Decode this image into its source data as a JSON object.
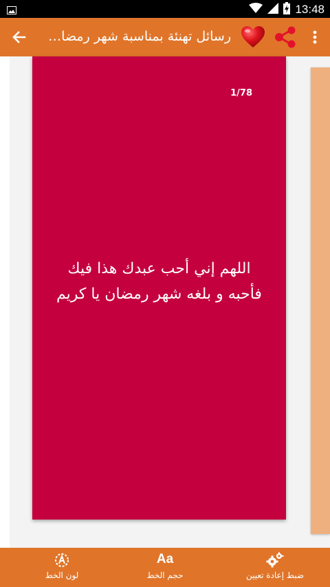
{
  "status_bar": {
    "time": "13:48",
    "battery_level": "charging"
  },
  "app_bar": {
    "title": "رسائل تهنئة بمناسبة شهر رمضان الكريم",
    "icons": [
      "back-arrow-icon",
      "heart-icon",
      "share-icon",
      "more-vert-icon"
    ],
    "color": "#e0752a"
  },
  "card": {
    "counter": "1/78",
    "message": "اللهم إني أحب عبدك هذا فيك\nفأحبه و بلغه شهر رمضان يا كريم",
    "background": "#c4003f",
    "next_card_color": "#efb07f"
  },
  "bottom_bar": {
    "text_color_label": "لون الخط",
    "font_size_label": "حجم الخط",
    "font_size_glyph": "Aa",
    "reset_label": "ضبط إعادة تعيين"
  }
}
